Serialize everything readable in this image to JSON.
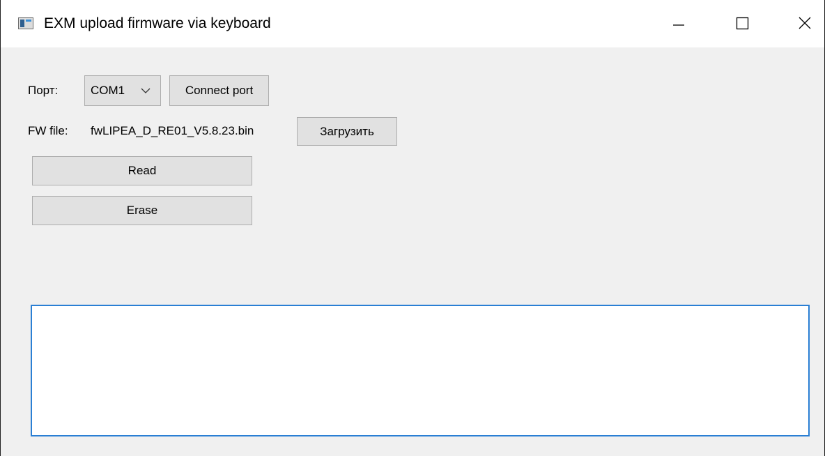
{
  "window": {
    "title": "EXM upload firmware via keyboard",
    "controls": {
      "minimize": "minimize-icon",
      "maximize": "maximize-icon",
      "close": "close-icon"
    }
  },
  "port": {
    "label": "Порт:",
    "selected": "COM1",
    "connect_label": "Connect port"
  },
  "firmware": {
    "label": "FW file:",
    "filename": "fwLIPEA_D_RE01_V5.8.23.bin",
    "load_label": "Загрузить"
  },
  "actions": {
    "read_label": "Read",
    "erase_label": "Erase"
  },
  "log": {
    "text": ""
  },
  "colors": {
    "accent": "#2a7fd4",
    "button_bg": "#e1e1e1",
    "window_bg": "#f0f0f0"
  }
}
